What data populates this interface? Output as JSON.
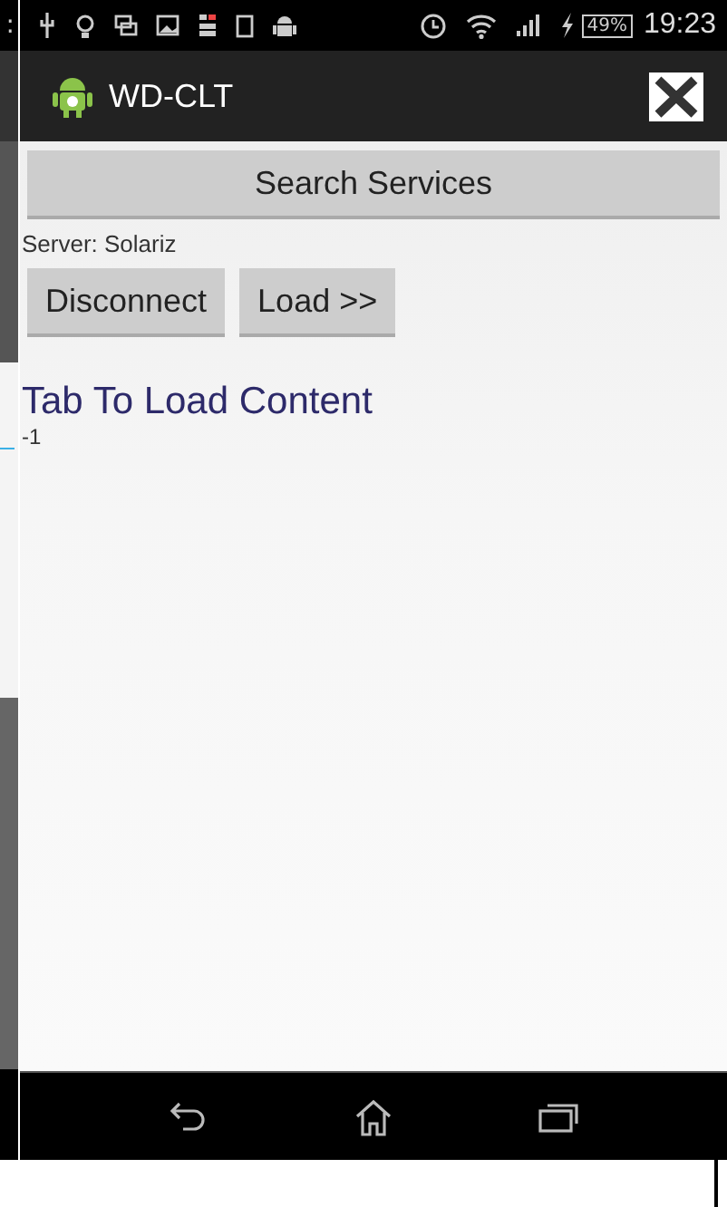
{
  "background_fragment": {
    "status_text": ":"
  },
  "status_bar": {
    "battery": "49%",
    "time": "19:23"
  },
  "action_bar": {
    "title": "WD-CLT"
  },
  "search_button": {
    "label": "Search Services"
  },
  "server_label": "Server: Solariz",
  "buttons": [
    {
      "label": "Disconnect"
    },
    {
      "label": "Load >>"
    }
  ],
  "content": {
    "heading": "Tab To Load Content",
    "value": "-1"
  }
}
